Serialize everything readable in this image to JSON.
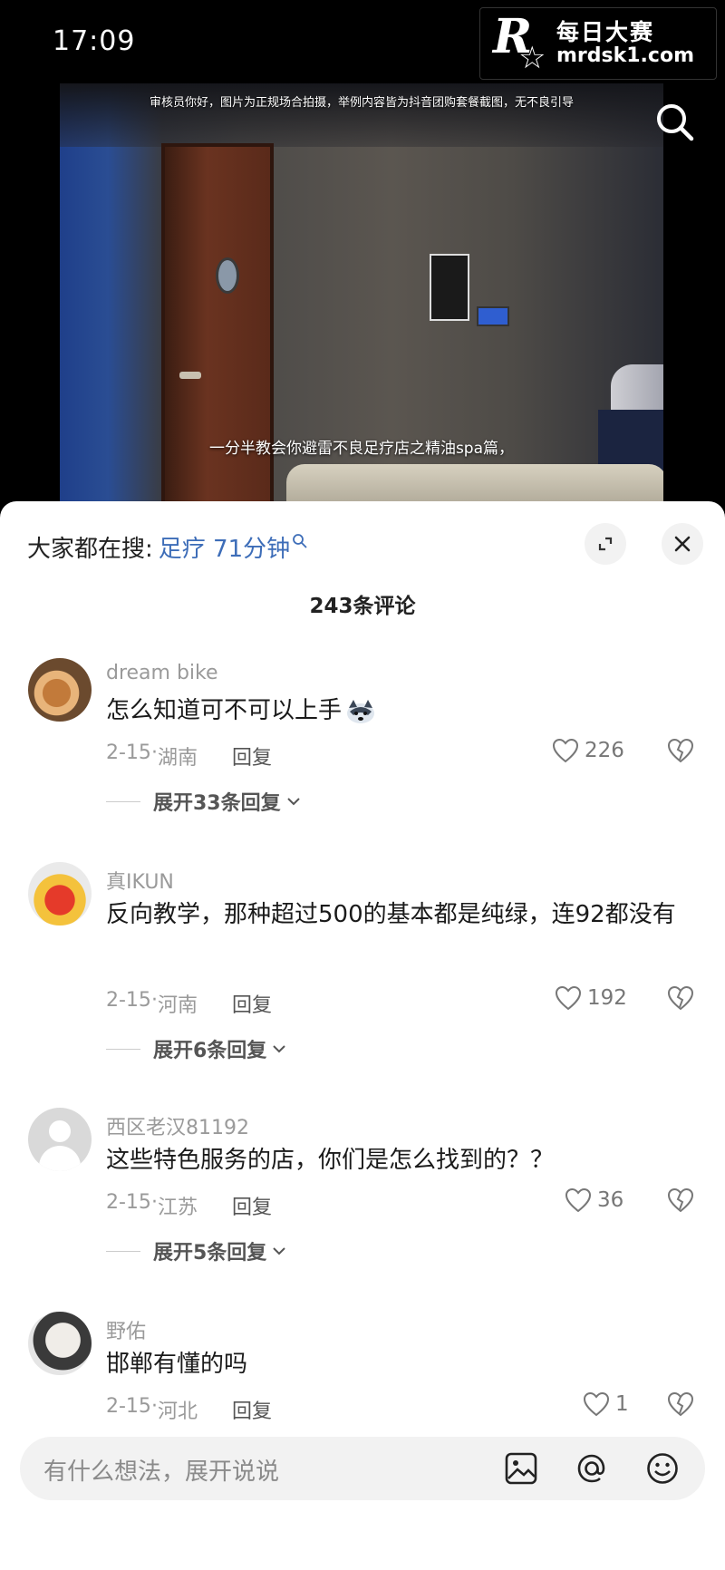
{
  "status_bar": {
    "time": "17:09"
  },
  "watermark": {
    "logo_letter": "R",
    "zh": "每日大赛",
    "en": "mrdsk1.com"
  },
  "video": {
    "top_notice": "审核员你好，图片为正规场合拍摄，举例内容皆为抖音团购套餐截图，无不良引导",
    "subtitle": "一分半教会你避雷不良足疗店之精油spa篇，"
  },
  "sheet": {
    "trending_prefix": "大家都在搜:",
    "trending_term": "足疗 71分钟",
    "comment_count": "243条评论"
  },
  "comments": [
    {
      "username": "dream bike",
      "text": "怎么知道可不可以上手",
      "date": "2-15",
      "region": "湖南",
      "reply_label": "回复",
      "likes": "226",
      "expand_label": "展开33条回复"
    },
    {
      "username": "真IKUN",
      "text": "反向教学，那种超过500的基本都是纯绿，连92都没有",
      "date": "2-15",
      "region": "河南",
      "reply_label": "回复",
      "likes": "192",
      "expand_label": "展开6条回复"
    },
    {
      "username": "西区老汉81192",
      "text": "这些特色服务的店，你们是怎么找到的？？",
      "date": "2-15",
      "region": "江苏",
      "reply_label": "回复",
      "likes": "36",
      "expand_label": "展开5条回复"
    },
    {
      "username": "野佑",
      "text": "邯郸有懂的吗",
      "date": "2-15",
      "region": "河北",
      "reply_label": "回复",
      "likes": "1"
    }
  ],
  "input": {
    "placeholder": "有什么想法，展开说说"
  },
  "colors": {
    "trending_term": "#3d6db8",
    "sheet_bg": "#ffffff",
    "input_bg": "#f2f2f2"
  }
}
